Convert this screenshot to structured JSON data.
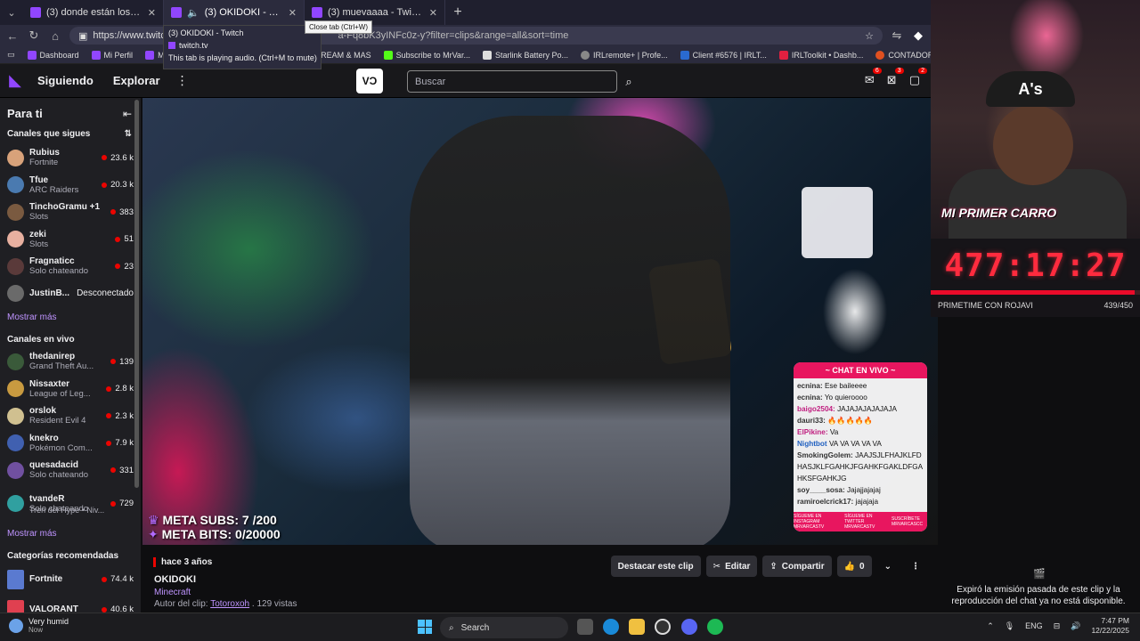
{
  "browser": {
    "tabs": [
      {
        "title": "(3) donde están los ríos que no tienen",
        "active": false
      },
      {
        "title": "(3) OKIDOKI - Twitch",
        "active": true
      },
      {
        "title": "(3) muevaaaa - Twitch",
        "active": false
      }
    ],
    "url": "https://www.twitch.tv",
    "url_rest": "a-Fq8bK3yINFc0z-y?filter=clips&range=all&sort=time",
    "close_tooltip": "Close tab (Ctrl+W)",
    "hovercard": {
      "title": "(3) OKIDOKI - Twitch",
      "site": "twitch.tv",
      "note": "This tab is playing audio. (Ctrl+M to mute)"
    },
    "bookmarks": [
      "Dashboard",
      "Mi Perfil",
      "M",
      "STREAM & MAS",
      "Subscribe to MrVar...",
      "Starlink Battery Po...",
      "IRLremote+ | Profe...",
      "Client #6576 | IRLT...",
      "IRLToolkit • Dashb...",
      "CONTADOR"
    ]
  },
  "twitch_nav": {
    "following": "Siguiendo",
    "explore": "Explorar",
    "search_placeholder": "Buscar",
    "badges": [
      "6",
      "3",
      "2"
    ]
  },
  "sidebar": {
    "title": "Para ti",
    "followed_header": "Canales que sigues",
    "followed": [
      {
        "name": "Rubius",
        "game": "Fortnite",
        "viewers": "23.6 k",
        "color": "#d8a27a"
      },
      {
        "name": "Tfue",
        "game": "ARC Raiders",
        "viewers": "20.3 k",
        "color": "#4a7ab0"
      },
      {
        "name": "TinchoGramu +1",
        "game": "Slots",
        "viewers": "383",
        "color": "#7a5a40"
      },
      {
        "name": "zeki",
        "game": "Slots",
        "viewers": "51",
        "color": "#e8b0a0"
      },
      {
        "name": "Fragnaticc",
        "game": "Solo chateando",
        "viewers": "23",
        "color": "#5a3a3a"
      }
    ],
    "offline": {
      "name": "JustinB...",
      "status": "Desconectado",
      "color": "#6a6a6a"
    },
    "show_more": "Mostrar más",
    "live_header": "Canales en vivo",
    "live": [
      {
        "name": "thedanirep",
        "game": "Grand Theft Au...",
        "viewers": "139",
        "color": "#3a5a3a"
      },
      {
        "name": "Nissaxter",
        "game": "League of Leg...",
        "viewers": "2.8 k",
        "color": "#c89a40"
      },
      {
        "name": "orslok",
        "game": "Resident Evil 4",
        "viewers": "2.3 k",
        "color": "#d0c090"
      },
      {
        "name": "knekro",
        "game": "Pokémon Com...",
        "viewers": "7.9 k",
        "color": "#4060b0"
      },
      {
        "name": "quesadacid",
        "game": "Solo chateando",
        "viewers": "331",
        "color": "#7050a0"
      },
      {
        "name": "tvandeR",
        "game": "Solo chateando",
        "viewers": "729",
        "color": "#30a0a0"
      }
    ],
    "hype": "Tren del Hype • Niv...",
    "show_more_2": "Mostrar más",
    "cat_header": "Categorías recomendadas",
    "categories": [
      {
        "name": "Fortnite",
        "viewers": "74.4 k",
        "color": "#5a7ad0"
      },
      {
        "name": "VALORANT",
        "viewers": "40.6 k",
        "color": "#e04050"
      }
    ]
  },
  "video": {
    "meta_subs": "META SUBS: 7 /200",
    "meta_bits": "META BITS: 0/20000",
    "chat_title": "~ CHAT EN VIVO ~",
    "chat": [
      {
        "user": "ecnina:",
        "text": "Ese baileeee"
      },
      {
        "user": "ecnina:",
        "text": "Yo quieroooo"
      },
      {
        "user": "baigo2504:",
        "text": "JAJAJAJAJAJAJA"
      },
      {
        "user": "dauri33:",
        "text": "🔥🔥🔥🔥🔥"
      },
      {
        "user": "ElPikine:",
        "text": "Va"
      },
      {
        "user": "Nightbot",
        "text": "VA VA VA VA VA"
      },
      {
        "user": "SmokingGolem:",
        "text": "JAAJSJLFHAJKLFDHASJKLFGAHKJFGAHKFGAKLDFGAHKSFGAHKJG"
      },
      {
        "user": "soy____sosa:",
        "text": "Jajajjajajaj"
      },
      {
        "user": "ramiroelcrick17:",
        "text": "jajajaja"
      }
    ],
    "chat_footer": [
      "SÍGUEME EN INSTAGRAM MRVARCASTV",
      "SÍGUEME EN TWITTER MRVARCASTV",
      "SUSCRÍBETE MRVARCASCC"
    ]
  },
  "clip": {
    "ago": "hace 3 años",
    "title": "OKIDOKI",
    "game": "Minecraft",
    "author_label": "Autor del clip:",
    "author": "Totoroxoh",
    "views": ". 129 vistas",
    "feature_btn": "Destacar este clip",
    "edit_btn": "Editar",
    "share_btn": "Compartir",
    "likes": "0"
  },
  "overlay": {
    "prize": "MI PRIMER CARRO",
    "cap_logo": "A's",
    "timer": "477:17:27",
    "progress_label": "PRIMETIME CON ROJAVI",
    "progress_count": "439/450",
    "progress_fraction": 0.9756
  },
  "right_panel": {
    "message": "Expiró la emisión pasada de este clip y la reproducción del chat ya no está disponible."
  },
  "taskbar": {
    "weather": "Very humid",
    "weather_sub": "Now",
    "search": "Search",
    "lang": "ENG",
    "time": "7:47 PM",
    "date": "12/22/2025"
  }
}
